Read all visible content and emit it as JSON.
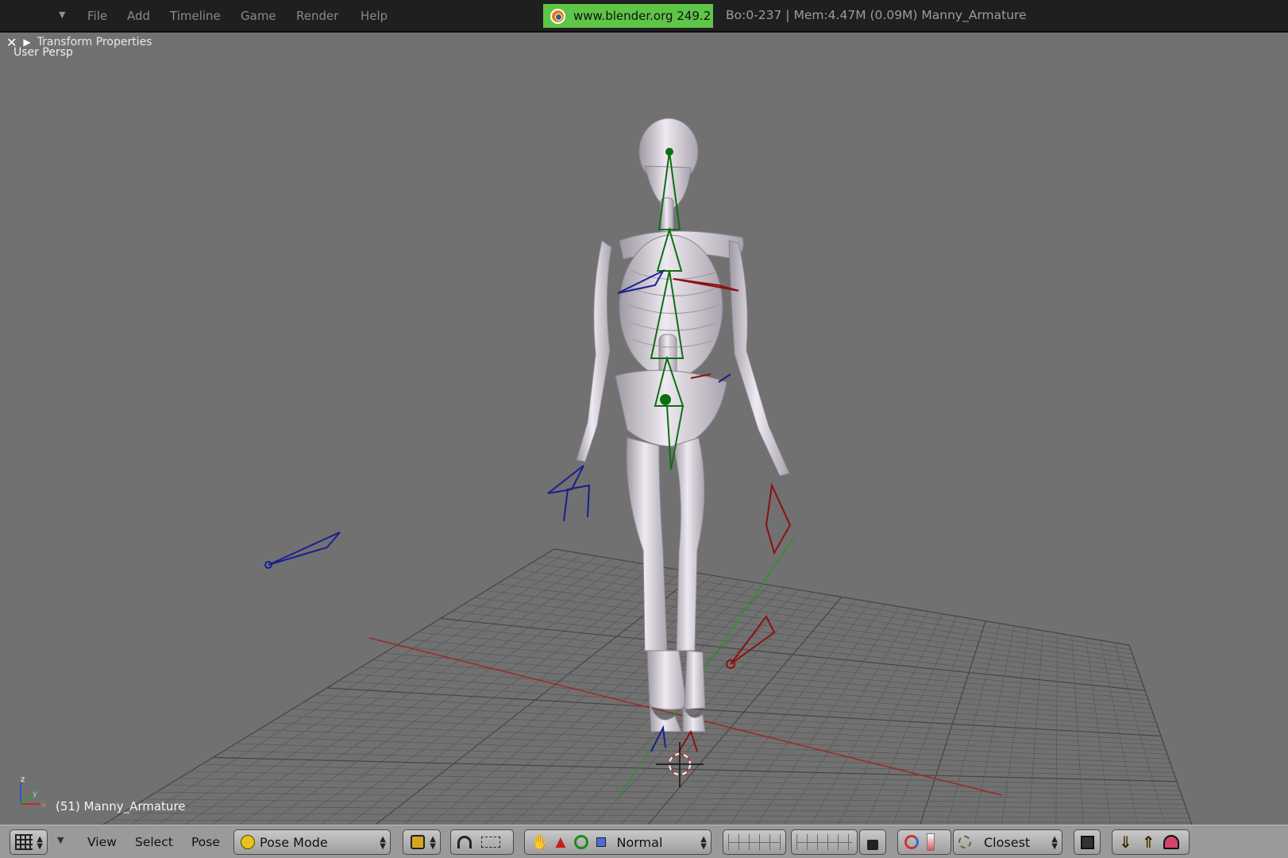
{
  "topbar": {
    "menus": [
      "File",
      "Add",
      "Timeline",
      "Game",
      "Render",
      "Help"
    ],
    "url": "www.blender.org 249.2",
    "stats": "Bo:0-237  | Mem:4.47M (0.09M) Manny_Armature"
  },
  "viewport": {
    "panel_title": "Transform Properties",
    "view_label": "User Persp",
    "object_label": "(51) Manny_Armature",
    "axis_labels": {
      "x": "x",
      "y": "y",
      "z": "z"
    }
  },
  "bottombar": {
    "view": "View",
    "select": "Select",
    "pose": "Pose",
    "mode": "Pose Mode",
    "pivot": "Normal",
    "snap": "Closest"
  },
  "colors": {
    "bone_center": "#0e6f12",
    "bone_left": "#1a1f8f",
    "bone_right": "#8d1010",
    "grid": "#555555",
    "x_axis": "#9a2a2a",
    "y_axis": "#2f8f2f"
  }
}
